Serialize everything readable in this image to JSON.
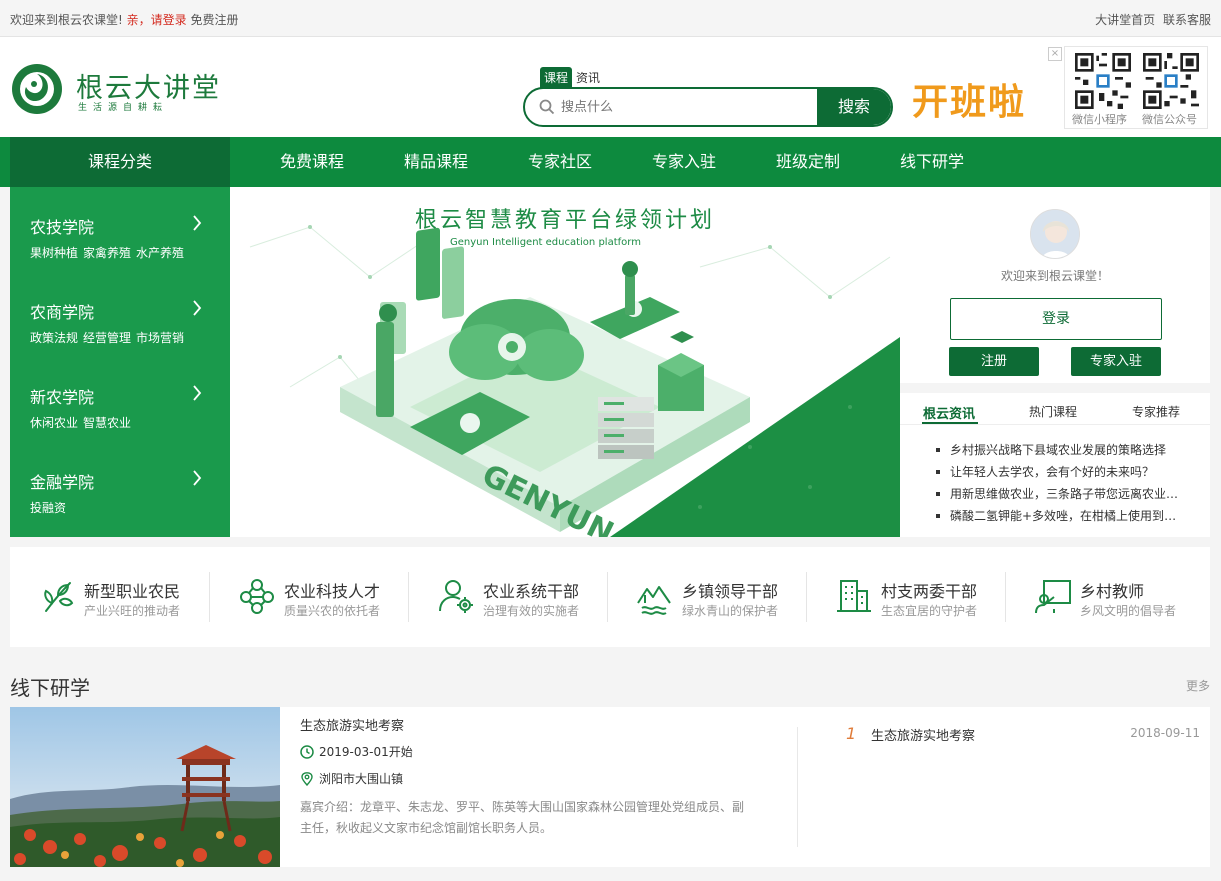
{
  "topbar": {
    "welcome": "欢迎来到根云农课堂!",
    "login_prompt": "亲，请登录",
    "register": "免费注册",
    "home_link": "大讲堂首页",
    "service_link": "联系客服"
  },
  "header": {
    "logo_name": "根云大讲堂",
    "logo_slogan": "生活源自耕耘",
    "search_tabs": [
      "课程",
      "资讯"
    ],
    "search_placeholder": "搜点什么",
    "search_button": "搜索",
    "promo": "开班啦",
    "qr_close": "×",
    "qr_labels": [
      "微信小程序",
      "微信公众号"
    ]
  },
  "nav": {
    "category": "课程分类",
    "items": [
      "免费课程",
      "精品课程",
      "专家社区",
      "专家入驻",
      "班级定制",
      "线下研学"
    ]
  },
  "sidebar": {
    "colleges": [
      {
        "title": "农技学院",
        "subs": [
          "果树种植",
          "家禽养殖",
          "水产养殖"
        ]
      },
      {
        "title": "农商学院",
        "subs": [
          "政策法规",
          "经营管理",
          "市场营销"
        ]
      },
      {
        "title": "新农学院",
        "subs": [
          "休闲农业",
          "智慧农业"
        ]
      },
      {
        "title": "金融学院",
        "subs": [
          "投融资"
        ]
      }
    ]
  },
  "banner": {
    "title": "根云智慧教育平台绿领计划",
    "subtitle": "Genyun Intelligent education platform",
    "mark": "GENYUN"
  },
  "user": {
    "welcome": "欢迎来到根云课堂！",
    "login": "登录",
    "register": "注册",
    "expert": "专家入驻"
  },
  "news": {
    "tabs": [
      "根云资讯",
      "热门课程",
      "专家推荐"
    ],
    "items": [
      "乡村振兴战略下县域农业发展的策略选择",
      "让年轻人去学农，会有个好的未来吗？",
      "用新思维做农业，三条路子带您远离农业陷阱",
      "磷酸二氢钾能+多效唑，在柑橘上使用到底有什么作用"
    ]
  },
  "categories": [
    {
      "title": "新型职业农民",
      "sub": "产业兴旺的推动者",
      "icon": "sprout-icon"
    },
    {
      "title": "农业科技人才",
      "sub": "质量兴农的依托者",
      "icon": "network-icon"
    },
    {
      "title": "农业系统干部",
      "sub": "治理有效的实施者",
      "icon": "user-gear-icon"
    },
    {
      "title": "乡镇领导干部",
      "sub": "绿水青山的保护者",
      "icon": "mountain-icon"
    },
    {
      "title": "村支两委干部",
      "sub": "生态宜居的守护者",
      "icon": "building-icon"
    },
    {
      "title": "乡村教师",
      "sub": "乡风文明的倡导者",
      "icon": "teacher-icon"
    }
  ],
  "offline": {
    "title": "线下研学",
    "more": "更多",
    "card": {
      "title": "生态旅游实地考察",
      "date": "2019-03-01开始",
      "location": "浏阳市大围山镇",
      "desc": "嘉宾介绍：龙章平、朱志龙、罗平、陈英等大围山国家森林公园管理处党组成员、副主任，秋收起义文家市纪念馆副馆长职务人员。"
    },
    "rank": {
      "num": "1",
      "title": "生态旅游实地考察",
      "date": "2018-09-11"
    }
  },
  "colors": {
    "brand_dark": "#0d6b35",
    "brand": "#0d8a3e",
    "sidebar": "#1a9a4c",
    "promo": "#f09a1c",
    "alert": "#d42b20"
  }
}
